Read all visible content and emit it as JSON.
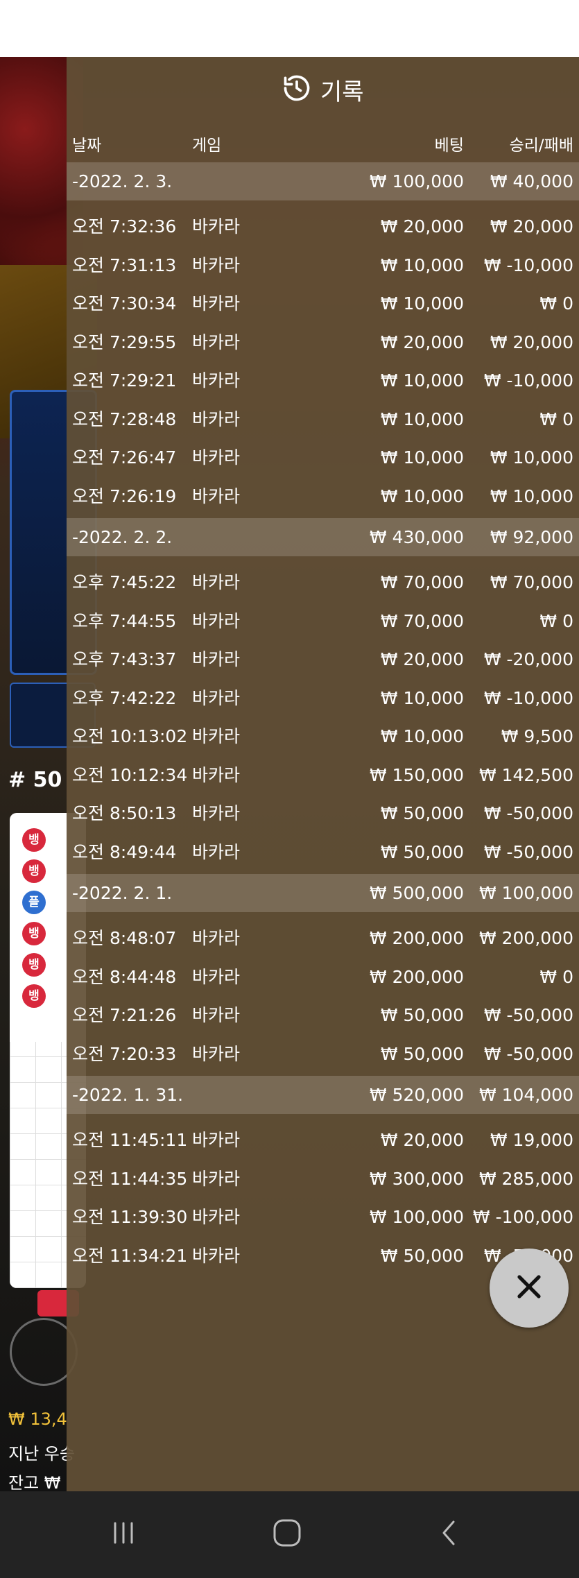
{
  "header": {
    "title": "기록",
    "history_icon": "history-icon"
  },
  "columns": {
    "date": "날짜",
    "game": "게임",
    "bet": "베팅",
    "result": "승리/패배"
  },
  "records": [
    {
      "type": "date",
      "date": "-2022. 2. 3.",
      "bet": "₩ 100,000",
      "result": "₩ 40,000"
    },
    {
      "type": "row",
      "time": "오전 7:32:36",
      "game": "바카라",
      "bet": "₩ 20,000",
      "result": "₩ 20,000"
    },
    {
      "type": "row",
      "time": "오전 7:31:13",
      "game": "바카라",
      "bet": "₩ 10,000",
      "result": "₩ -10,000"
    },
    {
      "type": "row",
      "time": "오전 7:30:34",
      "game": "바카라",
      "bet": "₩ 10,000",
      "result": "₩ 0"
    },
    {
      "type": "row",
      "time": "오전 7:29:55",
      "game": "바카라",
      "bet": "₩ 20,000",
      "result": "₩ 20,000"
    },
    {
      "type": "row",
      "time": "오전 7:29:21",
      "game": "바카라",
      "bet": "₩ 10,000",
      "result": "₩ -10,000"
    },
    {
      "type": "row",
      "time": "오전 7:28:48",
      "game": "바카라",
      "bet": "₩ 10,000",
      "result": "₩ 0"
    },
    {
      "type": "row",
      "time": "오전 7:26:47",
      "game": "바카라",
      "bet": "₩ 10,000",
      "result": "₩ 10,000"
    },
    {
      "type": "row",
      "time": "오전 7:26:19",
      "game": "바카라",
      "bet": "₩ 10,000",
      "result": "₩ 10,000"
    },
    {
      "type": "date",
      "date": "-2022. 2. 2.",
      "bet": "₩ 430,000",
      "result": "₩ 92,000"
    },
    {
      "type": "row",
      "time": "오후 7:45:22",
      "game": "바카라",
      "bet": "₩ 70,000",
      "result": "₩ 70,000"
    },
    {
      "type": "row",
      "time": "오후 7:44:55",
      "game": "바카라",
      "bet": "₩ 70,000",
      "result": "₩ 0"
    },
    {
      "type": "row",
      "time": "오후 7:43:37",
      "game": "바카라",
      "bet": "₩ 20,000",
      "result": "₩ -20,000"
    },
    {
      "type": "row",
      "time": "오후 7:42:22",
      "game": "바카라",
      "bet": "₩ 10,000",
      "result": "₩ -10,000"
    },
    {
      "type": "row",
      "time": "오전 10:13:02",
      "game": "바카라",
      "bet": "₩ 10,000",
      "result": "₩ 9,500"
    },
    {
      "type": "row",
      "time": "오전 10:12:34",
      "game": "바카라",
      "bet": "₩ 150,000",
      "result": "₩ 142,500"
    },
    {
      "type": "row",
      "time": "오전 8:50:13",
      "game": "바카라",
      "bet": "₩ 50,000",
      "result": "₩ -50,000"
    },
    {
      "type": "row",
      "time": "오전 8:49:44",
      "game": "바카라",
      "bet": "₩ 50,000",
      "result": "₩ -50,000"
    },
    {
      "type": "date",
      "date": "-2022. 2. 1.",
      "bet": "₩ 500,000",
      "result": "₩ 100,000"
    },
    {
      "type": "row",
      "time": "오전 8:48:07",
      "game": "바카라",
      "bet": "₩ 200,000",
      "result": "₩ 200,000"
    },
    {
      "type": "row",
      "time": "오전 8:44:48",
      "game": "바카라",
      "bet": "₩ 200,000",
      "result": "₩ 0"
    },
    {
      "type": "row",
      "time": "오전 7:21:26",
      "game": "바카라",
      "bet": "₩ 50,000",
      "result": "₩ -50,000"
    },
    {
      "type": "row",
      "time": "오전 7:20:33",
      "game": "바카라",
      "bet": "₩ 50,000",
      "result": "₩ -50,000"
    },
    {
      "type": "date",
      "date": "-2022. 1. 31.",
      "bet": "₩ 520,000",
      "result": "₩ 104,000"
    },
    {
      "type": "row",
      "time": "오전 11:45:11",
      "game": "바카라",
      "bet": "₩ 20,000",
      "result": "₩ 19,000"
    },
    {
      "type": "row",
      "time": "오전 11:44:35",
      "game": "바카라",
      "bet": "₩ 300,000",
      "result": "₩ 285,000"
    },
    {
      "type": "row",
      "time": "오전 11:39:30",
      "game": "바카라",
      "bet": "₩ 100,000",
      "result": "₩ -100,000"
    },
    {
      "type": "row",
      "time": "오전 11:34:21",
      "game": "바카라",
      "bet": "₩ 50,000",
      "result": "₩ -50,000"
    }
  ],
  "background": {
    "round_label": "# 50",
    "road_marks": [
      "뱅",
      "뱅",
      "플",
      "뱅",
      "뱅",
      "뱅"
    ],
    "balance_line": "₩ 13,4",
    "last_win_label": "지난 우승",
    "balance_label": "잔고 ₩"
  },
  "close_icon": "close-icon",
  "navbar": {
    "recent_icon": "recent-apps-icon",
    "home_icon": "home-icon",
    "back_icon": "back-icon"
  },
  "colors": {
    "overlay": "#625036",
    "date_band": "#8a7c6a",
    "balance_gold": "#f2c23a",
    "banker_red": "#d8283c",
    "player_blue": "#2f6fd0"
  }
}
